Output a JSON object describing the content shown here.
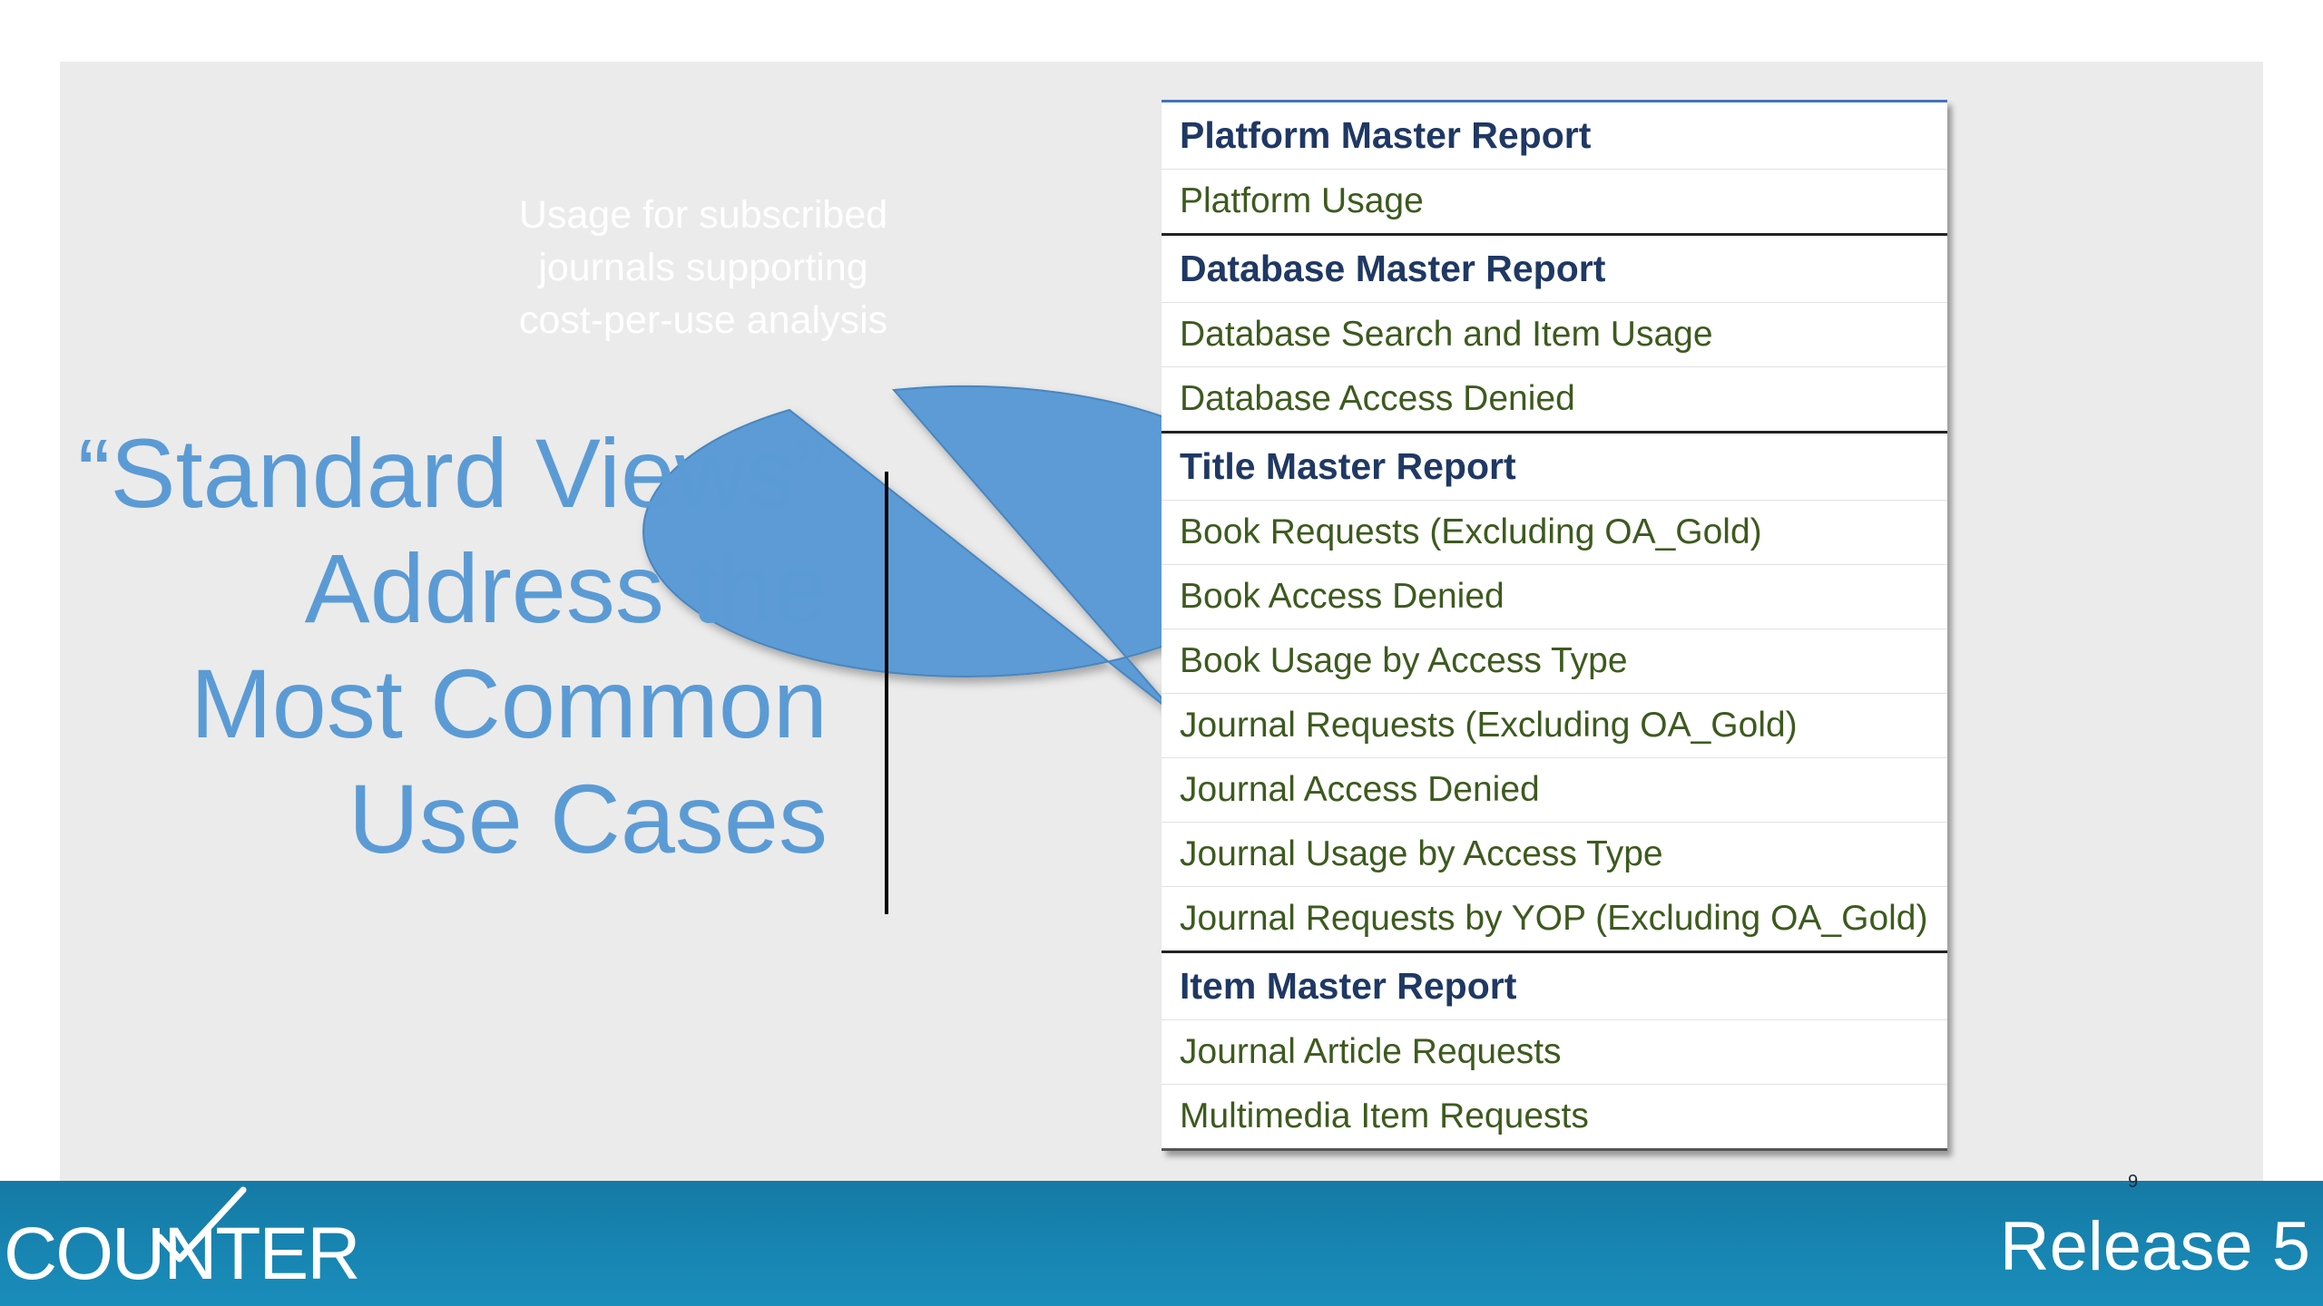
{
  "headline": {
    "lines": [
      "“Standard Views”",
      "Address the",
      "Most Common",
      "Use Cases"
    ]
  },
  "callout": {
    "lines": [
      "Usage for subscribed",
      "journals supporting",
      "cost-per-use analysis"
    ]
  },
  "reports": [
    {
      "master": "Platform Master Report",
      "views": [
        "Platform Usage"
      ]
    },
    {
      "master": "Database Master Report",
      "views": [
        "Database Search and Item Usage",
        "Database Access Denied"
      ]
    },
    {
      "master": "Title Master Report",
      "views": [
        "Book Requests (Excluding OA_Gold)",
        "Book Access Denied",
        "Book Usage by Access Type",
        "Journal Requests (Excluding OA_Gold)",
        "Journal Access Denied",
        "Journal Usage by Access Type",
        "Journal Requests by YOP (Excluding OA_Gold)"
      ]
    },
    {
      "master": "Item Master Report",
      "views": [
        "Journal Article Requests",
        "Multimedia Item Requests"
      ]
    }
  ],
  "footer": {
    "logo_text": "COUNTER",
    "release_label": "Release 5",
    "page_number": "9"
  },
  "colors": {
    "accent_blue": "#5b9bd5",
    "footer_blue": "#1a8dbb",
    "master_text": "#1f3864",
    "view_text": "#3d5a1e"
  }
}
